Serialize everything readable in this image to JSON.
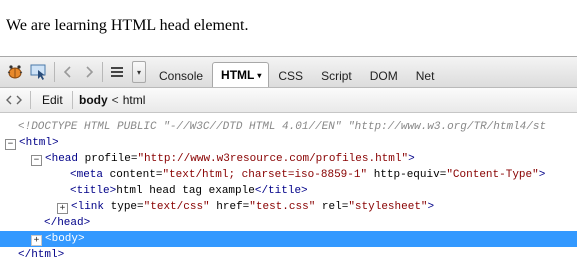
{
  "page": {
    "body_text": "We are learning HTML head element."
  },
  "toolbar": {
    "icons": [
      "firebug-icon",
      "inspect-icon",
      "back-icon",
      "forward-icon",
      "menu-icon"
    ],
    "dropdown_icon": "▾",
    "tabs": [
      {
        "label": "Console"
      },
      {
        "label": "HTML",
        "active": true
      },
      {
        "label": "CSS"
      },
      {
        "label": "Script"
      },
      {
        "label": "DOM"
      },
      {
        "label": "Net"
      }
    ]
  },
  "subtoolbar": {
    "edit_label": "Edit",
    "breadcrumbs": [
      "body",
      "html"
    ],
    "breadcrumb_separator": "<"
  },
  "html_panel": {
    "doctype": "<!DOCTYPE HTML PUBLIC \"-//W3C//DTD HTML 4.01//EN\" \"http://www.w3.org/TR/html4/st",
    "html_open": "<html>",
    "head_open_tag": "<head",
    "head_attr_name": "profile=",
    "head_attr_value": "\"http://www.w3resource.com/profiles.html\"",
    "head_open_close": ">",
    "meta_tag": "<meta",
    "meta_content_name": "content=",
    "meta_content_value": "\"text/html; charset=iso-8859-1\"",
    "meta_equiv_name": "http-equiv=",
    "meta_equiv_value": "\"Content-Type\"",
    "meta_close": ">",
    "title_open": "<title>",
    "title_text": "html head tag example",
    "title_close": "</title>",
    "link_tag": "<link",
    "link_type_name": "type=",
    "link_type_value": "\"text/css\"",
    "link_href_name": "href=",
    "link_href_value": "\"test.css\"",
    "link_rel_name": "rel=",
    "link_rel_value": "\"stylesheet\"",
    "link_close": ">",
    "head_close": "</head>",
    "body_tag": "<body>",
    "html_close": "</html>",
    "expanded_symbol": "−",
    "collapsed_symbol": "+"
  },
  "colors": {
    "tag": "#000088",
    "attribute_value": "#880000",
    "selection": "#3399ff"
  }
}
